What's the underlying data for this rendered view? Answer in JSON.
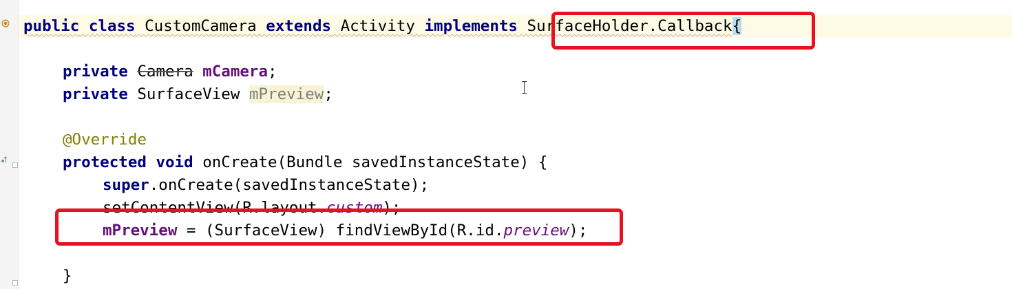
{
  "code": {
    "line1": {
      "t1": "public",
      "t2": " ",
      "t3": "class",
      "t4": " CustomCamera ",
      "t5": "extends",
      "t6": " Activity ",
      "t7": "implements",
      "t8": " SurfaceHolder.Callback",
      "t9": "{"
    },
    "line3": {
      "t1": "private",
      "t2": " ",
      "t3": "Camera",
      "t4": " ",
      "t5": "mCamera",
      "t6": ";"
    },
    "line4": {
      "t1": "private",
      "t2": " SurfaceView ",
      "t3": "mPreview",
      "t4": ";"
    },
    "line6": {
      "t1": "@Override"
    },
    "line7": {
      "t1": "protected",
      "t2": " ",
      "t3": "void",
      "t4": " onCreate(Bundle savedInstanceState) {"
    },
    "line8": {
      "t1": "super",
      "t2": ".onCreate(savedInstanceState);"
    },
    "line9": {
      "t1": "setContentView(R.layout.",
      "t2": "custom",
      "t3": ");"
    },
    "line10": {
      "t1": "mPreview",
      "t2": " = (SurfaceView) findViewById(R.id.",
      "t3": "preview",
      "t4": ");"
    },
    "line12": {
      "t1": "}"
    }
  },
  "colors": {
    "keyword": "#000080",
    "member": "#660e7a",
    "annotation": "#808000",
    "highlight_box": "#e8121c",
    "brace_match": "#b6dbf2"
  },
  "icons": {
    "class_marker": "class-icon",
    "override_marker": "override-gutter-icon",
    "fold": "fold-marker-icon"
  }
}
